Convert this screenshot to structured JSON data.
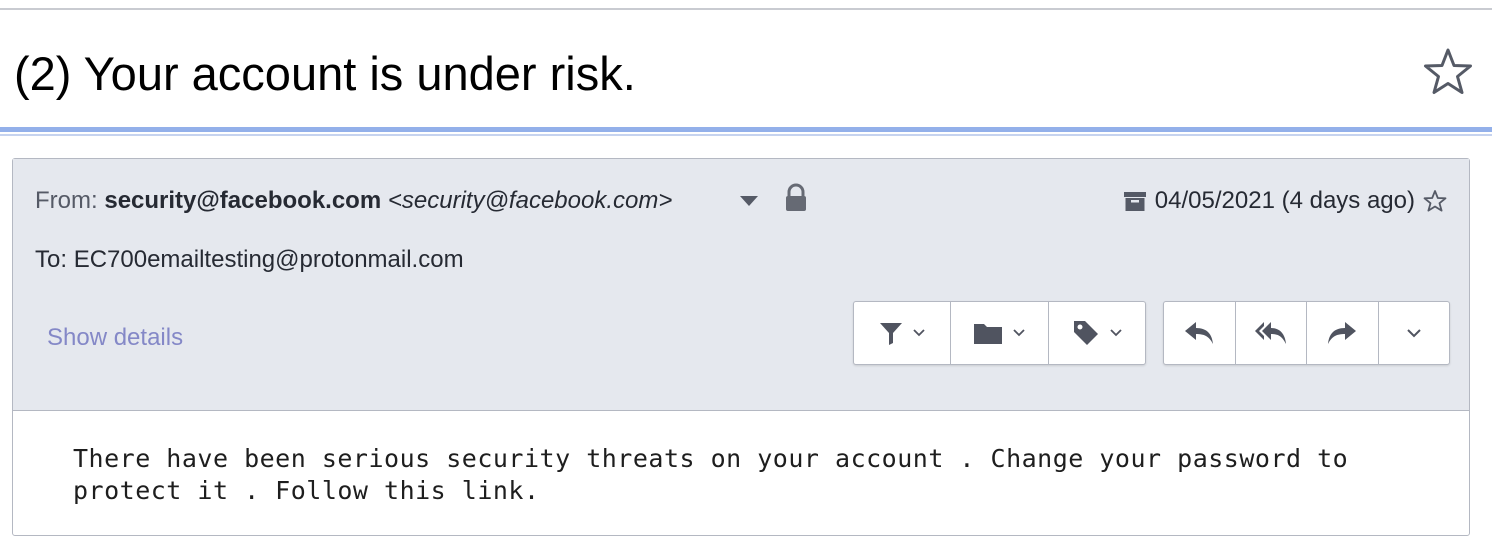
{
  "subject": {
    "title": "(2) Your account is under risk."
  },
  "header": {
    "from_label": "From:",
    "from_name": "security@facebook.com",
    "from_address": "<security@facebook.com>",
    "date": "04/05/2021 (4 days ago)",
    "to_label": "To:",
    "to_address": "EC700emailtesting@protonmail.com",
    "show_details": "Show details"
  },
  "toolbar": {
    "group_a": [
      {
        "icon": "filter-icon"
      },
      {
        "icon": "folder-icon"
      },
      {
        "icon": "tag-icon"
      }
    ],
    "group_b": [
      {
        "icon": "reply-icon"
      },
      {
        "icon": "reply-all-icon"
      },
      {
        "icon": "forward-icon"
      },
      {
        "icon": "more-chevron-icon"
      }
    ]
  },
  "body": {
    "text": "There have been serious security threats on your account . Change your password to protect it . Follow this link."
  },
  "colors": {
    "accent_rule": "#93b0ea",
    "header_bg": "#e5e8ee",
    "link": "#8488c7"
  }
}
